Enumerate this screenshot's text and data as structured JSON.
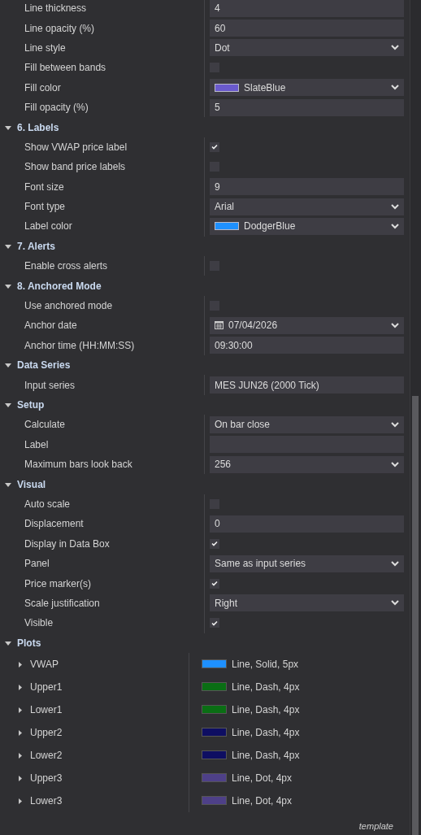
{
  "sections": [
    {
      "rows": [
        {
          "label": "Line thickness",
          "kind": "text",
          "value": "4"
        },
        {
          "label": "Line opacity (%)",
          "kind": "text",
          "value": "60"
        },
        {
          "label": "Line style",
          "kind": "select",
          "value": "Dot"
        },
        {
          "label": "Fill between bands",
          "kind": "checkbox",
          "checked": false
        },
        {
          "label": "Fill color",
          "kind": "color",
          "value": "SlateBlue",
          "color": "#6a5acd"
        },
        {
          "label": "Fill opacity (%)",
          "kind": "text",
          "value": "5"
        }
      ]
    },
    {
      "title": "6. Labels",
      "expanded": true,
      "rows": [
        {
          "label": "Show VWAP price label",
          "kind": "checkbox",
          "checked": true
        },
        {
          "label": "Show band price labels",
          "kind": "checkbox",
          "checked": false
        },
        {
          "label": "Font size",
          "kind": "text",
          "value": "9"
        },
        {
          "label": "Font type",
          "kind": "select",
          "value": "Arial"
        },
        {
          "label": "Label color",
          "kind": "color",
          "value": "DodgerBlue",
          "color": "#1e90ff"
        }
      ]
    },
    {
      "title": "7. Alerts",
      "expanded": true,
      "rows": [
        {
          "label": "Enable cross alerts",
          "kind": "checkbox",
          "checked": false
        }
      ]
    },
    {
      "title": "8. Anchored Mode",
      "expanded": true,
      "rows": [
        {
          "label": "Use anchored mode",
          "kind": "checkbox",
          "checked": false
        },
        {
          "label": "Anchor date",
          "kind": "date",
          "value": "07/04/2026"
        },
        {
          "label": "Anchor time  (HH:MM:SS)",
          "kind": "text",
          "value": "09:30:00"
        }
      ]
    },
    {
      "title": "Data Series",
      "expanded": true,
      "rows": [
        {
          "label": "Input series",
          "kind": "text",
          "value": "MES JUN26 (2000 Tick)"
        }
      ]
    },
    {
      "title": "Setup",
      "expanded": true,
      "rows": [
        {
          "label": "Calculate",
          "kind": "select",
          "value": "On bar close"
        },
        {
          "label": "Label",
          "kind": "text"
        },
        {
          "label": "Maximum bars look back",
          "kind": "select",
          "value": "256"
        }
      ]
    },
    {
      "title": "Visual",
      "expanded": true,
      "rows": [
        {
          "label": "Auto scale",
          "kind": "checkbox",
          "checked": false
        },
        {
          "label": "Displacement",
          "kind": "text",
          "value": "0"
        },
        {
          "label": "Display in Data Box",
          "kind": "checkbox",
          "checked": true
        },
        {
          "label": "Panel",
          "kind": "select",
          "value": "Same as input series"
        },
        {
          "label": "Price marker(s)",
          "kind": "checkbox",
          "checked": true
        },
        {
          "label": "Scale justification",
          "kind": "select",
          "value": "Right"
        },
        {
          "label": "Visible",
          "kind": "checkbox",
          "checked": true
        }
      ]
    }
  ],
  "plots": {
    "title": "Plots",
    "expanded": true,
    "items": [
      {
        "name": "VWAP",
        "expanded": false,
        "color": "#1e90ff",
        "value": "Line, Solid, 5px"
      },
      {
        "name": "Upper1",
        "expanded": false,
        "color": "#0a6e14",
        "value": "Line, Dash, 4px"
      },
      {
        "name": "Lower1",
        "expanded": false,
        "color": "#0a6e14",
        "value": "Line, Dash, 4px"
      },
      {
        "name": "Upper2",
        "expanded": false,
        "color": "#0e0e62",
        "value": "Line, Dash, 4px"
      },
      {
        "name": "Lower2",
        "expanded": false,
        "color": "#0e0e62",
        "value": "Line, Dash, 4px"
      },
      {
        "name": "Upper3",
        "expanded": false,
        "color": "#4e4088",
        "value": "Line, Dot, 4px"
      },
      {
        "name": "Lower3",
        "expanded": false,
        "color": "#4e4088",
        "value": "Line, Dot, 4px"
      }
    ]
  },
  "footer": "template"
}
